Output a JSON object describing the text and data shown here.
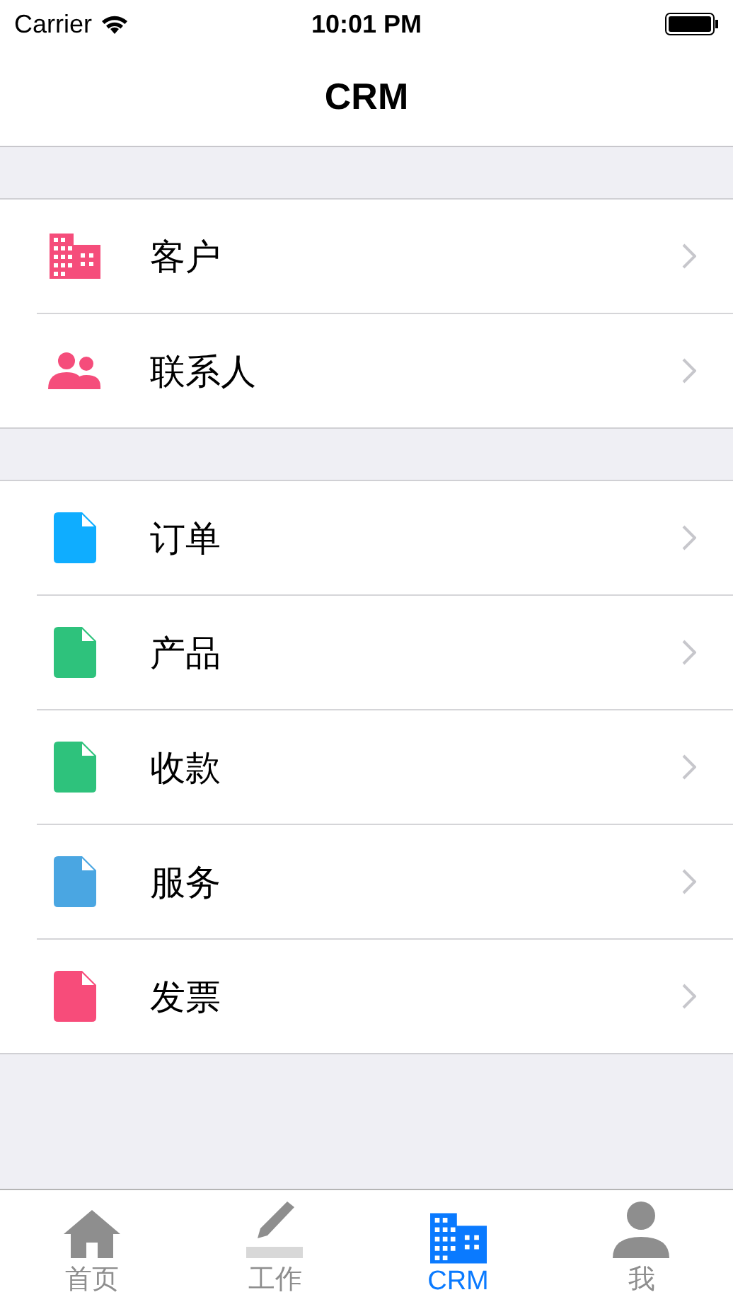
{
  "status_bar": {
    "carrier": "Carrier",
    "time": "10:01 PM"
  },
  "nav": {
    "title": "CRM"
  },
  "groups": [
    {
      "items": [
        {
          "label": "客户",
          "kind": "building",
          "color": "#f54d7b"
        },
        {
          "label": "联系人",
          "kind": "people",
          "color": "#f54d7b"
        }
      ]
    },
    {
      "items": [
        {
          "label": "订单",
          "kind": "file",
          "color": "#0fadff"
        },
        {
          "label": "产品",
          "kind": "file",
          "color": "#2ec27c"
        },
        {
          "label": "收款",
          "kind": "file",
          "color": "#2ec27c"
        },
        {
          "label": "服务",
          "kind": "file",
          "color": "#4aa6e2"
        },
        {
          "label": "发票",
          "kind": "file",
          "color": "#f74c7a"
        }
      ]
    }
  ],
  "tabs": [
    {
      "label": "首页",
      "kind": "home",
      "selected": false
    },
    {
      "label": "工作",
      "kind": "pencil",
      "selected": false
    },
    {
      "label": "CRM",
      "kind": "building",
      "selected": true
    },
    {
      "label": "我",
      "kind": "person",
      "selected": false
    }
  ]
}
